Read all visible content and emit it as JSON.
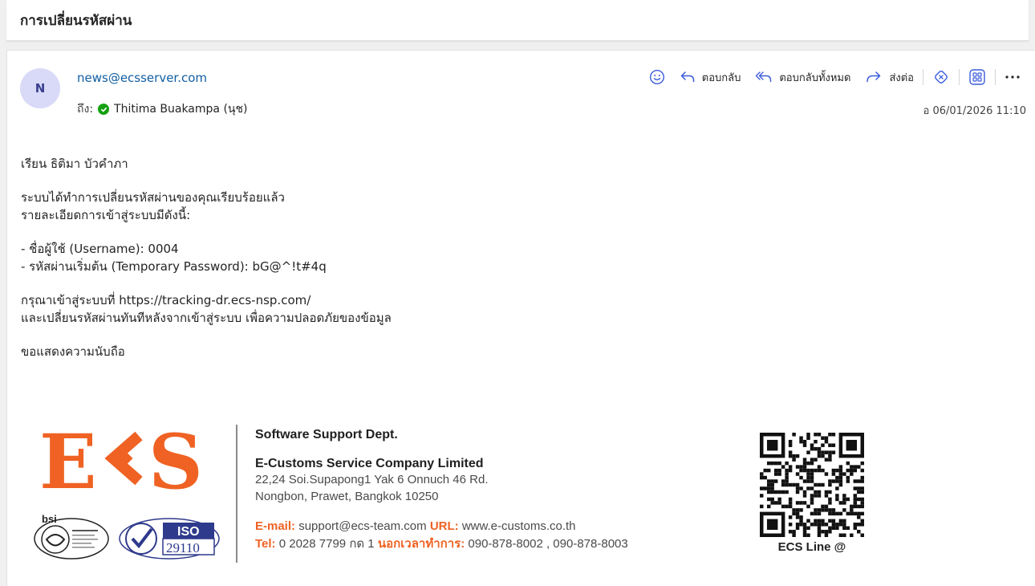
{
  "subject": "การเปลี่ยนรหัสผ่าน",
  "message": {
    "avatar_initial": "N",
    "sender": "news@ecsserver.com",
    "to_label": "ถึง:",
    "to_name": "Thitima Buakampa (นุช)",
    "timestamp": "อ 06/01/2026 11:10"
  },
  "toolbar": {
    "reply_label": "ตอบกลับ",
    "reply_all_label": "ตอบกลับทั้งหมด",
    "forward_label": "ส่งต่อ",
    "icons": [
      "smiley-icon",
      "reply-icon",
      "reply-all-icon",
      "forward-icon",
      "immersive-reader-icon",
      "apps-icon",
      "more-icon"
    ]
  },
  "body": {
    "greeting": "เรียน ธิติมา บัวคำภา",
    "line1": "ระบบได้ทำการเปลี่ยนรหัสผ่านของคุณเรียบร้อยแล้ว",
    "line2": "รายละเอียดการเข้าสู่ระบบมีดังนี้:",
    "username_line": "- ชื่อผู้ใช้ (Username): 0004",
    "password_line": "- รหัสผ่านเริ่มต้น (Temporary Password): bG@^!t#4q",
    "login_line": "กรุณาเข้าสู่ระบบที่ https://tracking-dr.ecs-nsp.com/",
    "change_line": "และเปลี่ยนรหัสผ่านทันทีหลังจากเข้าสู่ระบบ เพื่อความปลอดภัยของข้อมูล",
    "closing": "ขอแสดงความนับถือ"
  },
  "signature": {
    "logo_e": "E",
    "logo_s": "S",
    "bsi_label": "bsi",
    "iso_label": "ISO",
    "iso_number": "29110",
    "dept": "Software  Support Dept.",
    "company": "E-Customs Service Company Limited",
    "address1": "22,24 Soi.Supapong1  Yak 6  Onnuch 46  Rd.",
    "address2": "Nongbon,  Prawet,  Bangkok 10250",
    "email_label": "E-mail:",
    "email": "support@ecs-team.com",
    "url_label": "URL:",
    "url": "www.e-customs.co.th",
    "tel_label": "Tel:",
    "tel": "0 2028 7799 กด 1",
    "after_hours_label": "นอกเวลาทำการ:",
    "after_hours": "090-878-8002 , 090-878-8003",
    "qr_label": "ECS Line @",
    "brand_color": "#ef6223"
  }
}
